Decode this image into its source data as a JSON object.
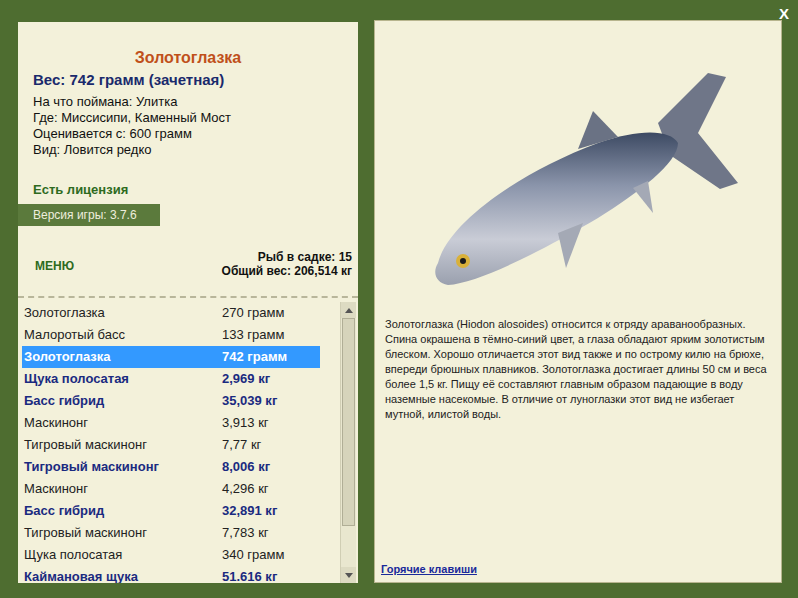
{
  "close": "X",
  "fish_card": {
    "title": "Золотоглазка",
    "weight": "Вес: 742 грамм (зачетная)",
    "info": [
      "На что поймана: Улитка",
      "Где: Миссисипи, Каменный Мост",
      "Оценивается с: 600 грамм",
      "Вид: Ловится редко"
    ]
  },
  "license": "Есть лицензия",
  "version": "Версия игры: 3.7.6",
  "menu": "МЕНЮ",
  "keepnet": {
    "count": "Рыб в садке: 15",
    "total": "Общий вес: 206,514 кг"
  },
  "fish_list": [
    {
      "name": "Золотоглазка",
      "weight": "270 грамм",
      "trophy": false,
      "selected": false
    },
    {
      "name": "Малоротый басс",
      "weight": "133 грамм",
      "trophy": false,
      "selected": false
    },
    {
      "name": "Золотоглазка",
      "weight": "742 грамм",
      "trophy": false,
      "selected": true
    },
    {
      "name": "Щука полосатая",
      "weight": "2,969 кг",
      "trophy": true,
      "selected": false
    },
    {
      "name": "Басс гибрид",
      "weight": "35,039 кг",
      "trophy": true,
      "selected": false
    },
    {
      "name": "Маскинонг",
      "weight": "3,913 кг",
      "trophy": false,
      "selected": false
    },
    {
      "name": "Тигровый маскинонг",
      "weight": "7,77 кг",
      "trophy": false,
      "selected": false
    },
    {
      "name": "Тигровый маскинонг",
      "weight": "8,006 кг",
      "trophy": true,
      "selected": false
    },
    {
      "name": "Маскинонг",
      "weight": "4,296 кг",
      "trophy": false,
      "selected": false
    },
    {
      "name": "Басс гибрид",
      "weight": "32,891 кг",
      "trophy": true,
      "selected": false
    },
    {
      "name": "Тигровый маскинонг",
      "weight": "7,783 кг",
      "trophy": false,
      "selected": false
    },
    {
      "name": "Щука полосатая",
      "weight": "340 грамм",
      "trophy": false,
      "selected": false
    },
    {
      "name": "Каймановая щука",
      "weight": "51.616 кг",
      "trophy": true,
      "selected": false
    }
  ],
  "description": "Золотоглазка (Hiodon alosoides) относится к отряду араванообразных. Спина окрашена в тёмно-синий цвет, а глаза обладают ярким золотистым блеском. Хорошо отличается этот вид также и по острому килю на брюхе, впереди брюшных плавников. Золотоглазка достигает длины 50 см и веса более 1,5 кг. Пищу её составляют главным образом падающие в воду наземные насекомые. В отличие от луноглазки этот вид не избегает мутной, илистой воды.",
  "hotkeys": "Горячие клавиши"
}
